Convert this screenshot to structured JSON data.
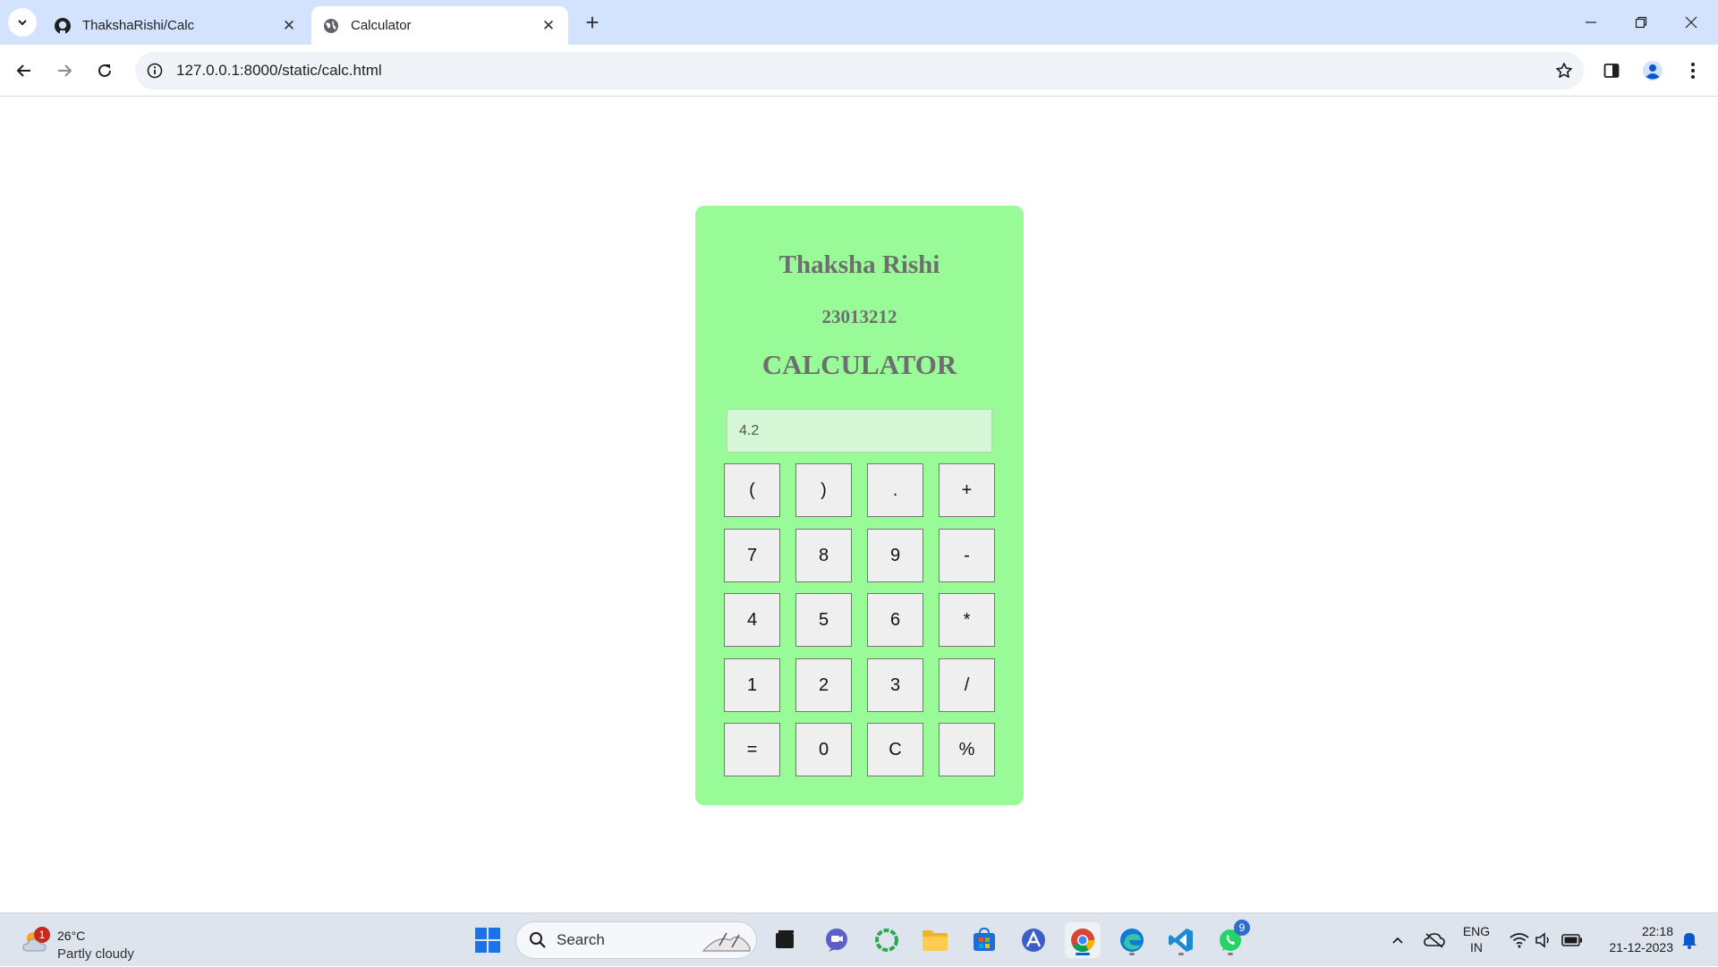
{
  "browser": {
    "tabs": [
      {
        "title": "ThakshaRishi/Calc",
        "favicon": "github-icon",
        "active": false
      },
      {
        "title": "Calculator",
        "favicon": "globe-icon",
        "active": true
      }
    ],
    "url": "127.0.0.1:8000/static/calc.html"
  },
  "calculator": {
    "name": "Thaksha Rishi",
    "reg_no": "23013212",
    "heading": "CALCULATOR",
    "display_value": "4.2",
    "keys": [
      [
        "(",
        ")",
        ".",
        "+"
      ],
      [
        "7",
        "8",
        "9",
        "-"
      ],
      [
        "4",
        "5",
        "6",
        "*"
      ],
      [
        "1",
        "2",
        "3",
        "/"
      ],
      [
        "=",
        "0",
        "C",
        "%"
      ]
    ],
    "colors": {
      "panel": "#98fb98",
      "display": "#d6f7d6",
      "text": "#6e6e6e"
    }
  },
  "taskbar": {
    "weather": {
      "temp": "26°C",
      "condition": "Partly cloudy",
      "badge": "1"
    },
    "search_label": "Search",
    "apps": [
      "start-icon",
      "search-icon",
      "task-view-icon",
      "teams-icon",
      "copilot-icon",
      "file-explorer-icon",
      "store-icon",
      "app-icon",
      "chrome-icon",
      "edge-icon",
      "vscode-icon",
      "whatsapp-icon"
    ],
    "whatsapp_badge": "9",
    "language": {
      "line1": "ENG",
      "line2": "IN"
    },
    "time": "22:18",
    "date": "21-12-2023"
  }
}
